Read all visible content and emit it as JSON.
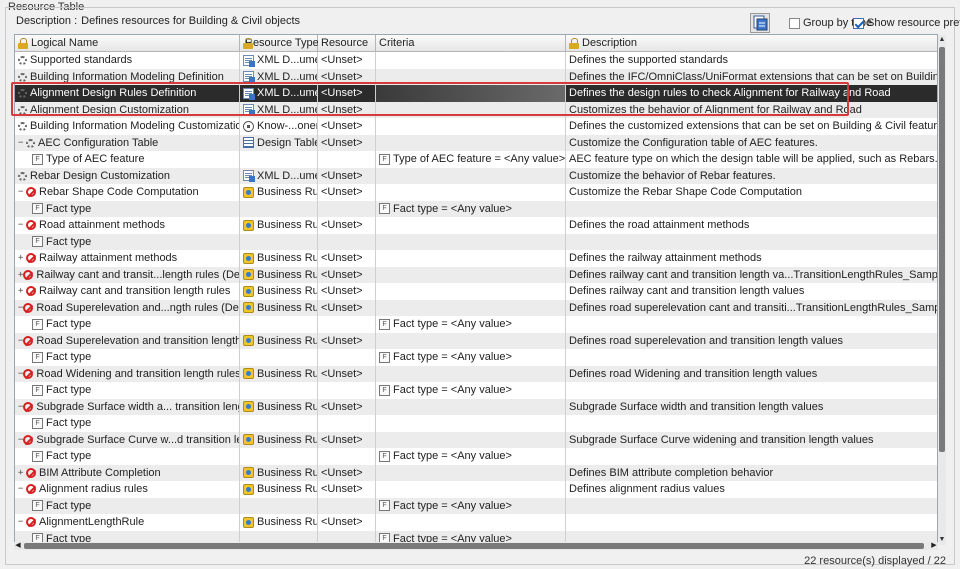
{
  "panel": {
    "legend": "Resource Table",
    "description_label": "Description :",
    "description_value": "Defines resources for Building & Civil objects",
    "group_by_type_label": "Group by type",
    "group_by_type_checked": false,
    "show_preview_label": "Show resource preview",
    "show_preview_checked": true
  },
  "columns": [
    {
      "label": "Logical Name",
      "locked": true
    },
    {
      "label": "Resource Type",
      "locked": true
    },
    {
      "label": "Resource",
      "locked": false
    },
    {
      "label": "Criteria",
      "locked": false
    },
    {
      "label": "Description",
      "locked": true
    }
  ],
  "rows": [
    {
      "exp": "",
      "state": "gear",
      "indent": 0,
      "name": "Supported standards",
      "type_icon": "xml-icon",
      "type": "XML D...ument",
      "resource": "<Unset>",
      "criteria": "",
      "desc": "Defines the supported standards"
    },
    {
      "exp": "",
      "state": "gear",
      "indent": 0,
      "name": "Building Information Modeling Definition",
      "type_icon": "xml-icon",
      "type": "XML D...ument",
      "resource": "<Unset>",
      "criteria": "",
      "desc": "Defines the IFC/OmniClass/UniFormat extensions that can be set on Building & Civil objects"
    },
    {
      "exp": "",
      "state": "gear",
      "indent": 0,
      "name": "Alignment Design Rules Definition",
      "type_icon": "xml-icon",
      "type": "XML D...ument",
      "resource": "<Unset>",
      "criteria": "",
      "desc": "Defines the design rules to check Alignment for Railway and Road",
      "selected": true
    },
    {
      "exp": "",
      "state": "gear",
      "indent": 0,
      "name": "Alignment Design Customization",
      "type_icon": "xml-icon",
      "type": "XML D...ument",
      "resource": "<Unset>",
      "criteria": "",
      "desc": "Customizes the behavior of Alignment for Railway and Road"
    },
    {
      "exp": "",
      "state": "gear",
      "indent": 0,
      "name": "Building Information Modeling Customization",
      "type_icon": "knowledge-icon",
      "type": "Know-...onent",
      "resource": "<Unset>",
      "criteria": "",
      "desc": "Defines the customized extensions that can be set on Building & Civil features"
    },
    {
      "exp": "-",
      "state": "gear",
      "indent": 1,
      "name": "AEC Configuration Table",
      "type_icon": "table-icon",
      "type": "Design Table",
      "resource": "<Unset>",
      "criteria": "",
      "desc": "Customize the Configuration table of AEC features."
    },
    {
      "exp": "",
      "state": "fact",
      "indent": 2,
      "name": "Type of AEC feature",
      "type_icon": "",
      "type": "",
      "resource": "",
      "criteria": "Type of AEC feature = <Any value>",
      "desc": "AEC feature type on which the design table will be applied, such as Rebars."
    },
    {
      "exp": "",
      "state": "gear",
      "indent": 0,
      "name": "Rebar Design Customization",
      "type_icon": "xml-icon",
      "type": "XML D...ument",
      "resource": "<Unset>",
      "criteria": "",
      "desc": "Customize the behavior of Rebar features."
    },
    {
      "exp": "-",
      "state": "forbid",
      "indent": 1,
      "name": "Rebar Shape Code Computation",
      "type_icon": "rule-icon",
      "type": "Business Rule",
      "resource": "<Unset>",
      "criteria": "",
      "desc": "Customize the Rebar Shape Code Computation"
    },
    {
      "exp": "",
      "state": "fact",
      "indent": 2,
      "name": "Fact type",
      "type_icon": "",
      "type": "",
      "resource": "",
      "criteria": "Fact type = <Any value>",
      "desc": ""
    },
    {
      "exp": "-",
      "state": "forbid",
      "indent": 1,
      "name": "Road attainment methods",
      "type_icon": "rule-icon",
      "type": "Business Rule",
      "resource": "<Unset>",
      "criteria": "",
      "desc": "Defines the road attainment methods"
    },
    {
      "exp": "",
      "state": "fact",
      "indent": 2,
      "name": "Fact type",
      "type_icon": "",
      "type": "",
      "resource": "",
      "criteria": "",
      "desc": ""
    },
    {
      "exp": "+",
      "state": "forbid",
      "indent": 1,
      "name": "Railway attainment methods",
      "type_icon": "rule-icon",
      "type": "Business Rule",
      "resource": "<Unset>",
      "criteria": "",
      "desc": "Defines the railway attainment methods"
    },
    {
      "exp": "+",
      "state": "forbid",
      "indent": 1,
      "name": "Railway cant and transit...length rules (Deprecated)",
      "type_icon": "rule-icon",
      "type": "Business Rule",
      "resource": "<Unset>",
      "criteria": "",
      "desc": "Defines railway cant and transition length va...TransitionLengthRules_Sample for more details."
    },
    {
      "exp": "+",
      "state": "forbid",
      "indent": 1,
      "name": "Railway cant and transition length rules",
      "type_icon": "rule-icon",
      "type": "Business Rule",
      "resource": "<Unset>",
      "criteria": "",
      "desc": "Defines railway cant and transition length values"
    },
    {
      "exp": "-",
      "state": "forbid",
      "indent": 1,
      "name": "Road Superelevation and...ngth rules (Deprecated)",
      "type_icon": "rule-icon",
      "type": "Business Rule",
      "resource": "<Unset>",
      "criteria": "",
      "desc": "Defines road superelevation cant and transiti...TransitionLengthRules_Sample for more details."
    },
    {
      "exp": "",
      "state": "fact",
      "indent": 2,
      "name": "Fact type",
      "type_icon": "",
      "type": "",
      "resource": "",
      "criteria": "Fact type = <Any value>",
      "desc": ""
    },
    {
      "exp": "-",
      "state": "forbid",
      "indent": 1,
      "name": "Road Superelevation and transition length rules",
      "type_icon": "rule-icon",
      "type": "Business Rule",
      "resource": "<Unset>",
      "criteria": "",
      "desc": "Defines road superelevation and transition length values"
    },
    {
      "exp": "",
      "state": "fact",
      "indent": 2,
      "name": "Fact type",
      "type_icon": "",
      "type": "",
      "resource": "",
      "criteria": "Fact type = <Any value>",
      "desc": ""
    },
    {
      "exp": "-",
      "state": "forbid",
      "indent": 1,
      "name": "Road Widening and transition length rules",
      "type_icon": "rule-icon",
      "type": "Business Rule",
      "resource": "<Unset>",
      "criteria": "",
      "desc": "Defines road Widening and transition length values"
    },
    {
      "exp": "",
      "state": "fact",
      "indent": 2,
      "name": "Fact type",
      "type_icon": "",
      "type": "",
      "resource": "",
      "criteria": "Fact type = <Any value>",
      "desc": ""
    },
    {
      "exp": "-",
      "state": "forbid",
      "indent": 1,
      "name": "Subgrade Surface width a... transition length rules",
      "type_icon": "rule-icon",
      "type": "Business Rule",
      "resource": "<Unset>",
      "criteria": "",
      "desc": "Subgrade Surface  width and transition length values"
    },
    {
      "exp": "",
      "state": "fact",
      "indent": 2,
      "name": "Fact type",
      "type_icon": "",
      "type": "",
      "resource": "",
      "criteria": "",
      "desc": ""
    },
    {
      "exp": "-",
      "state": "forbid",
      "indent": 1,
      "name": "Subgrade Surface Curve w...d transition length rule",
      "type_icon": "rule-icon",
      "type": "Business Rule",
      "resource": "<Unset>",
      "criteria": "",
      "desc": "Subgrade Surface  Curve widening and transition length values"
    },
    {
      "exp": "",
      "state": "fact",
      "indent": 2,
      "name": "Fact type",
      "type_icon": "",
      "type": "",
      "resource": "",
      "criteria": "Fact type = <Any value>",
      "desc": ""
    },
    {
      "exp": "+",
      "state": "forbid",
      "indent": 1,
      "name": "BIM Attribute Completion",
      "type_icon": "rule-icon",
      "type": "Business Rule",
      "resource": "<Unset>",
      "criteria": "",
      "desc": "Defines BIM attribute completion behavior"
    },
    {
      "exp": "-",
      "state": "forbid",
      "indent": 1,
      "name": "Alignment radius rules",
      "type_icon": "rule-icon",
      "type": "Business Rule",
      "resource": "<Unset>",
      "criteria": "",
      "desc": "Defines alignment radius values"
    },
    {
      "exp": "",
      "state": "fact",
      "indent": 2,
      "name": "Fact type",
      "type_icon": "",
      "type": "",
      "resource": "",
      "criteria": "Fact type = <Any value>",
      "desc": ""
    },
    {
      "exp": "-",
      "state": "forbid",
      "indent": 1,
      "name": "AlignmentLengthRule",
      "type_icon": "rule-icon",
      "type": "Business Rule",
      "resource": "<Unset>",
      "criteria": "",
      "desc": ""
    },
    {
      "exp": "",
      "state": "fact",
      "indent": 2,
      "name": "Fact type",
      "type_icon": "",
      "type": "",
      "resource": "",
      "criteria": "Fact type = <Any value>",
      "desc": ""
    }
  ],
  "status": "22 resource(s) displayed / 22"
}
